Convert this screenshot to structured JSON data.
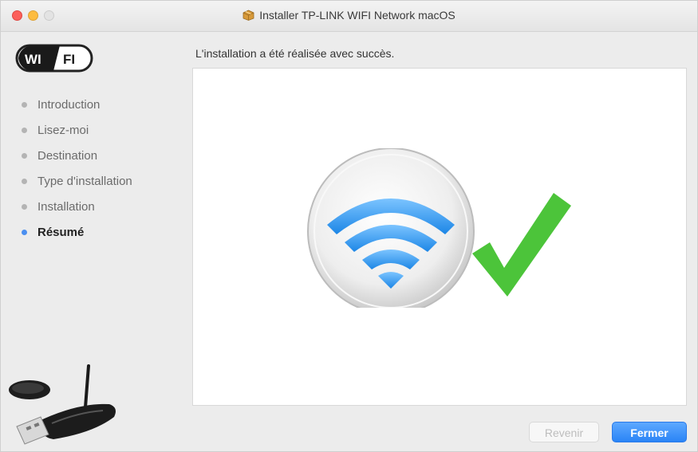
{
  "window": {
    "title": "Installer TP-LINK WIFI Network macOS"
  },
  "sidebar": {
    "logo_text_left": "WI",
    "logo_text_right": "FI",
    "steps": [
      {
        "label": "Introduction",
        "state": "done"
      },
      {
        "label": "Lisez-moi",
        "state": "done"
      },
      {
        "label": "Destination",
        "state": "done"
      },
      {
        "label": "Type d'installation",
        "state": "done"
      },
      {
        "label": "Installation",
        "state": "done"
      },
      {
        "label": "Résumé",
        "state": "active"
      }
    ]
  },
  "main": {
    "heading": "L'installation a été réalisée avec succès."
  },
  "buttons": {
    "back_label": "Revenir",
    "close_label": "Fermer"
  },
  "colors": {
    "accent": "#4b8ff0",
    "success_check": "#4cc43a",
    "wifi_blue": "#3aa0ee"
  },
  "icons": {
    "hero": "wifi-icon",
    "status": "checkmark-icon",
    "title": "package-icon",
    "product": "usb-adapter-icon"
  }
}
